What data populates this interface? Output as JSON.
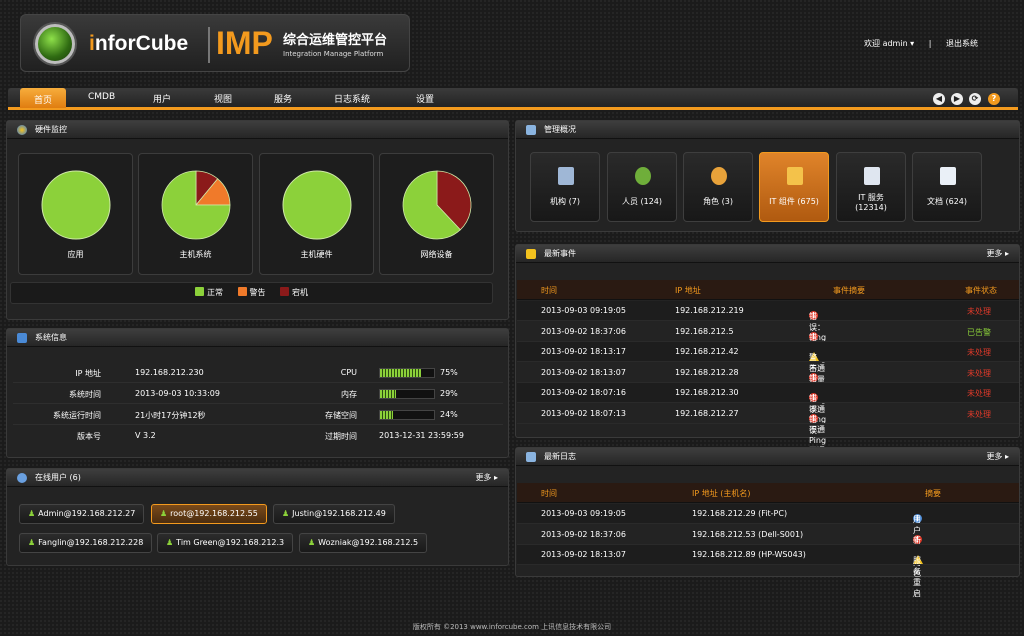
{
  "header": {
    "brand_i": "i",
    "brand_rest": "nforCube",
    "product": "IMP",
    "platform_cn": "综合运维管控平台",
    "platform_en": "Integration Manage Platform",
    "welcome": "欢迎 admin ▾",
    "divider": "|",
    "logout": "退出系统"
  },
  "nav": {
    "items": [
      "首页",
      "CMDB",
      "用户",
      "视图",
      "服务",
      "日志系统",
      "设置"
    ],
    "icons": [
      "arrow-left-icon",
      "arrow-right-icon",
      "refresh-icon",
      "help-icon"
    ],
    "icon_glyphs": [
      "◀",
      "▶",
      "⟳",
      "?"
    ]
  },
  "hardware": {
    "title": "硬件监控",
    "pies": [
      {
        "label": "应用",
        "normal": 100,
        "warning": 0,
        "down": 0
      },
      {
        "label": "主机系统",
        "normal": 75,
        "warning": 14,
        "down": 11
      },
      {
        "label": "主机硬件",
        "normal": 100,
        "warning": 0,
        "down": 0
      },
      {
        "label": "网络设备",
        "normal": 62,
        "warning": 0,
        "down": 38
      }
    ],
    "legend": [
      {
        "label": "正常",
        "color": "#8cd13a"
      },
      {
        "label": "警告",
        "color": "#f07a2a"
      },
      {
        "label": "宕机",
        "color": "#8b1a1a"
      }
    ]
  },
  "system": {
    "title": "系统信息",
    "rows": [
      {
        "k1": "IP 地址",
        "v1": "192.168.212.230",
        "k2": "CPU",
        "pct": 75,
        "pct_label": "75%"
      },
      {
        "k1": "系统时间",
        "v1": "2013-09-03 10:33:09",
        "k2": "内存",
        "pct": 29,
        "pct_label": "29%"
      },
      {
        "k1": "系统运行时间",
        "v1": "21小时17分钟12秒",
        "k2": "存储空间",
        "pct": 24,
        "pct_label": "24%"
      },
      {
        "k1": "版本号",
        "v1": "V 3.2",
        "k2": "过期时间",
        "v2": "2013-12-31 23:59:59"
      }
    ]
  },
  "online": {
    "title": "在线用户 (6)",
    "more": "更多 ▸",
    "users": [
      "Admin@192.168.212.27",
      "root@192.168.212.55",
      "Justin@192.168.212.49",
      "Fanglin@192.168.212.228",
      "Tim Green@192.168.212.3",
      "Wozniak@192.168.212.5"
    ]
  },
  "overview": {
    "title": "管理概况",
    "items": [
      {
        "label": "机构 (7)",
        "icon": "building-icon",
        "color": "#9fb7d6"
      },
      {
        "label": "人员 (124)",
        "icon": "people-icon",
        "color": "#6fae3a"
      },
      {
        "label": "角色 (3)",
        "icon": "medal-icon",
        "color": "#e8a23a"
      },
      {
        "label": "IT 组件 (675)",
        "icon": "boxes-icon",
        "color": "#f4c24a"
      },
      {
        "label": "IT 服务\n(12314)",
        "icon": "service-doc-icon",
        "color": "#dfe6f0"
      },
      {
        "label": "文档 (624)",
        "icon": "document-icon",
        "color": "#eaf0f7"
      }
    ]
  },
  "events": {
    "title": "最新事件",
    "more": "更多 ▸",
    "headers": [
      "时间",
      "IP 地址",
      "事件摘要",
      "事件状态"
    ],
    "rows": [
      {
        "time": "2013-09-03 09:19:05",
        "ip": "192.168.212.219",
        "type": "error",
        "summary": "错误：Ping 不通",
        "status": "未处理",
        "status_color": "#e03a2a"
      },
      {
        "time": "2013-09-02 18:37:06",
        "ip": "192.168.212.5",
        "type": "error",
        "summary": "错误：Ping 不通",
        "status": "已告警",
        "status_color": "#8cd13a"
      },
      {
        "time": "2013-09-02 18:13:17",
        "ip": "192.168.212.42",
        "type": "warn",
        "summary": "警告：容量异常",
        "status": "未处理",
        "status_color": "#e03a2a"
      },
      {
        "time": "2013-09-02 18:13:07",
        "ip": "192.168.212.28",
        "type": "error",
        "summary": "错误：Ping 不通",
        "status": "未处理",
        "status_color": "#e03a2a"
      },
      {
        "time": "2013-09-02 18:07:16",
        "ip": "192.168.212.30",
        "type": "error",
        "summary": "错误：Ping 不通",
        "status": "未处理",
        "status_color": "#e03a2a"
      },
      {
        "time": "2013-09-02 18:07:13",
        "ip": "192.168.212.27",
        "type": "error",
        "summary": "错误：Ping 不通",
        "status": "未处理",
        "status_color": "#e03a2a"
      }
    ]
  },
  "logs": {
    "title": "最新日志",
    "more": "更多 ▸",
    "headers": [
      "时间",
      "IP 地址 (主机名)",
      "摘要"
    ],
    "rows": [
      {
        "time": "2013-09-03 09:19:05",
        "ip": "192.168.212.29 (Fit-PC)",
        "type": "info",
        "summary": "用户登录"
      },
      {
        "time": "2013-09-02 18:37:06",
        "ip": "192.168.212.53 (Dell-S001)",
        "type": "error",
        "summary": "新增角色"
      },
      {
        "time": "2013-09-02 18:13:07",
        "ip": "192.168.212.89 (HP-WS043)",
        "type": "warn",
        "summary": "服务重启"
      }
    ]
  },
  "footer": "版权所有 ©2013 www.inforcube.com 上讯信息技术有限公司"
}
